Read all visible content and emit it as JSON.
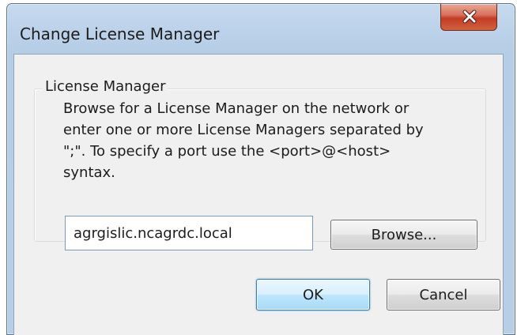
{
  "window": {
    "title": "Change License Manager",
    "close_label": "X"
  },
  "group": {
    "label": "License Manager",
    "description_lines": [
      "Browse for a License Manager on the network or",
      "enter one or more License Managers separated by",
      "\";\".  To specify a port use the <port>@<host>",
      "syntax."
    ]
  },
  "server_input": {
    "value": "agrgislic.ncagrdc.local"
  },
  "buttons": {
    "browse": "Browse...",
    "ok": "OK",
    "cancel": "Cancel"
  },
  "icons": {
    "close": "close-icon"
  },
  "colors": {
    "title_bar": "#bdd3ea",
    "close_button": "#c94a2e",
    "client_bg": "#f0f0f0",
    "default_button_border": "#3c7fb1"
  }
}
